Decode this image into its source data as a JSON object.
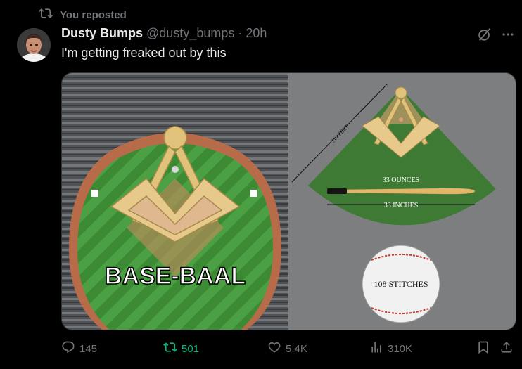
{
  "repost_banner": {
    "text": "You reposted",
    "icon": "repost-icon"
  },
  "author": {
    "display_name": "Dusty Bumps",
    "handle": "@dusty_bumps",
    "separator": "·",
    "time": "20h"
  },
  "tweet": {
    "text": "I'm getting freaked out by this"
  },
  "media": {
    "left_image": {
      "overlay_text": "BASE-BAAL"
    },
    "right_image": {
      "measure_feet": "314 FEET",
      "measure_ounces": "33 OUNCES",
      "measure_inches": "33 INCHES",
      "stitches": "108 STITCHES"
    }
  },
  "actions": {
    "replies": "145",
    "reposts": "501",
    "likes": "5.4K",
    "views": "310K"
  },
  "colors": {
    "background": "#000000",
    "muted": "#71767b",
    "repost_active": "#00ba7c"
  }
}
